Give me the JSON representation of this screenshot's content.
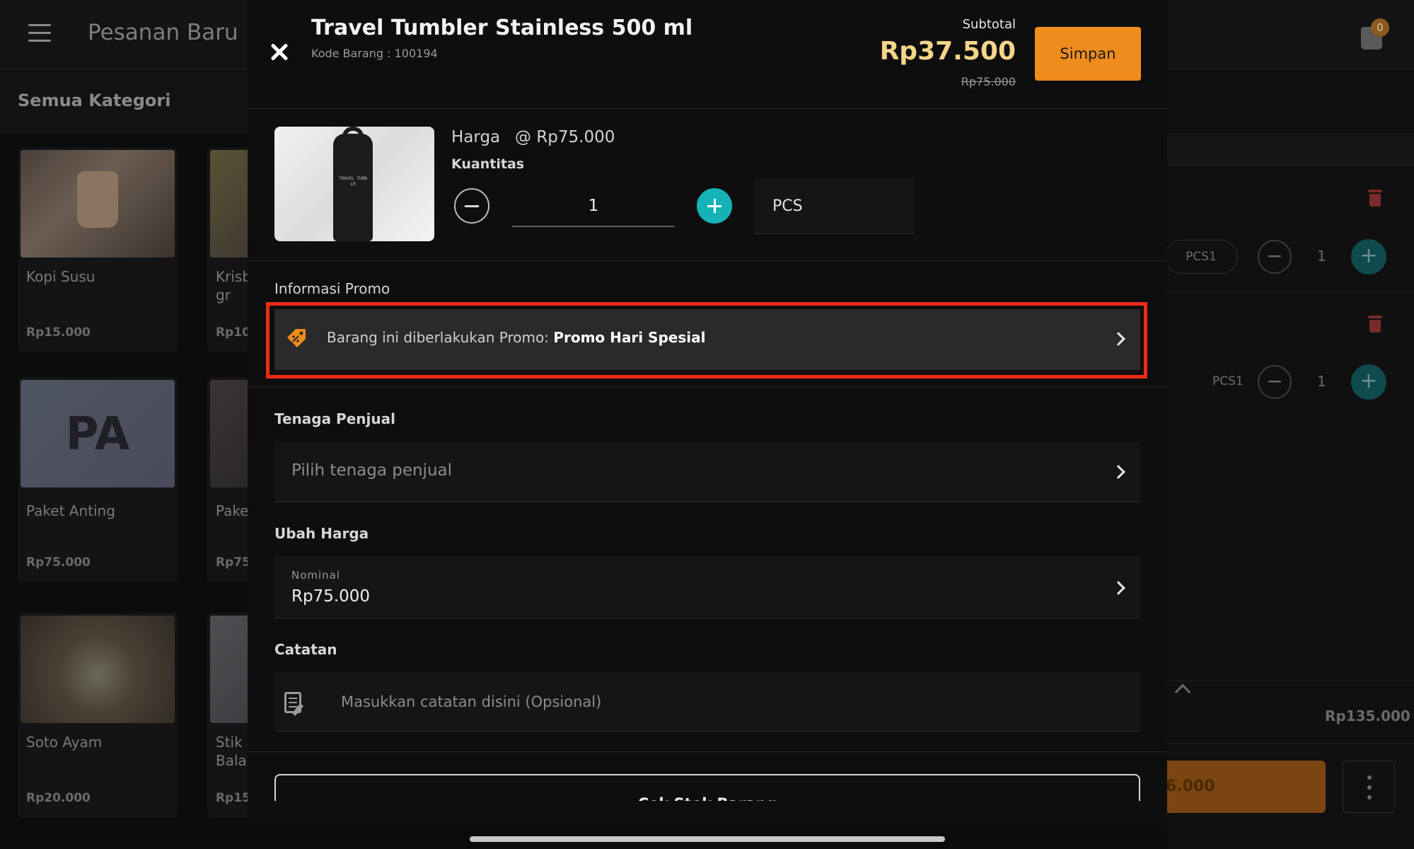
{
  "app": {
    "page_title": "Pesanan Baru",
    "cart_count": "0",
    "category_title": "Semua Kategori"
  },
  "products": [
    {
      "name": "Kopi Susu",
      "price": "Rp15.000",
      "image": "coffee"
    },
    {
      "name": "Krisb gr",
      "price": "Rp10.",
      "image": "yellow"
    },
    {
      "name": "Paket Anting",
      "price": "Rp75.000",
      "image": "pa",
      "image_text": "PA"
    },
    {
      "name": "Pake",
      "price": "Rp75.",
      "image": "dark"
    },
    {
      "name": "Soto Ayam",
      "price": "Rp20.000",
      "image": "soto"
    },
    {
      "name": "Stik S Bala",
      "price": "Rp15.",
      "image": "grey"
    }
  ],
  "cart_panel": {
    "rows": [
      {
        "unit": "PCS1",
        "qty": "1"
      },
      {
        "unit": "PCS1",
        "qty": "1"
      }
    ],
    "total": "Rp135.000",
    "pay_label": "6.000"
  },
  "modal": {
    "title": "Travel Tumbler Stainless 500 ml",
    "code": "Kode Barang : 100194",
    "subtotal_label": "Subtotal",
    "subtotal_value": "Rp37.500",
    "subtotal_original": "Rp75.000",
    "save_label": "Simpan",
    "product_image_text": "TRAVEL TUMB LR",
    "price_label": "Harga",
    "price_value": "@ Rp75.000",
    "qty_label": "Kuantitas",
    "qty_value": "1",
    "unit": "PCS",
    "promo_section": "Informasi Promo",
    "promo_prefix": "Barang ini diberlakukan Promo: ",
    "promo_name": "Promo Hari Spesial",
    "sales_section": "Tenaga Penjual",
    "sales_placeholder": "Pilih tenaga penjual",
    "price_change_section": "Ubah Harga",
    "price_change_caption": "Nominal",
    "price_change_value": "Rp75.000",
    "note_section": "Catatan",
    "note_placeholder": "Masukkan catatan disini (Opsional)",
    "stock_button": "Cek Stok Barang"
  },
  "colors": {
    "accent_orange": "#f08c1c",
    "subtotal_gold": "#f5d58a",
    "plus_teal": "#15b3b8",
    "highlight_red": "#ee2a17"
  }
}
